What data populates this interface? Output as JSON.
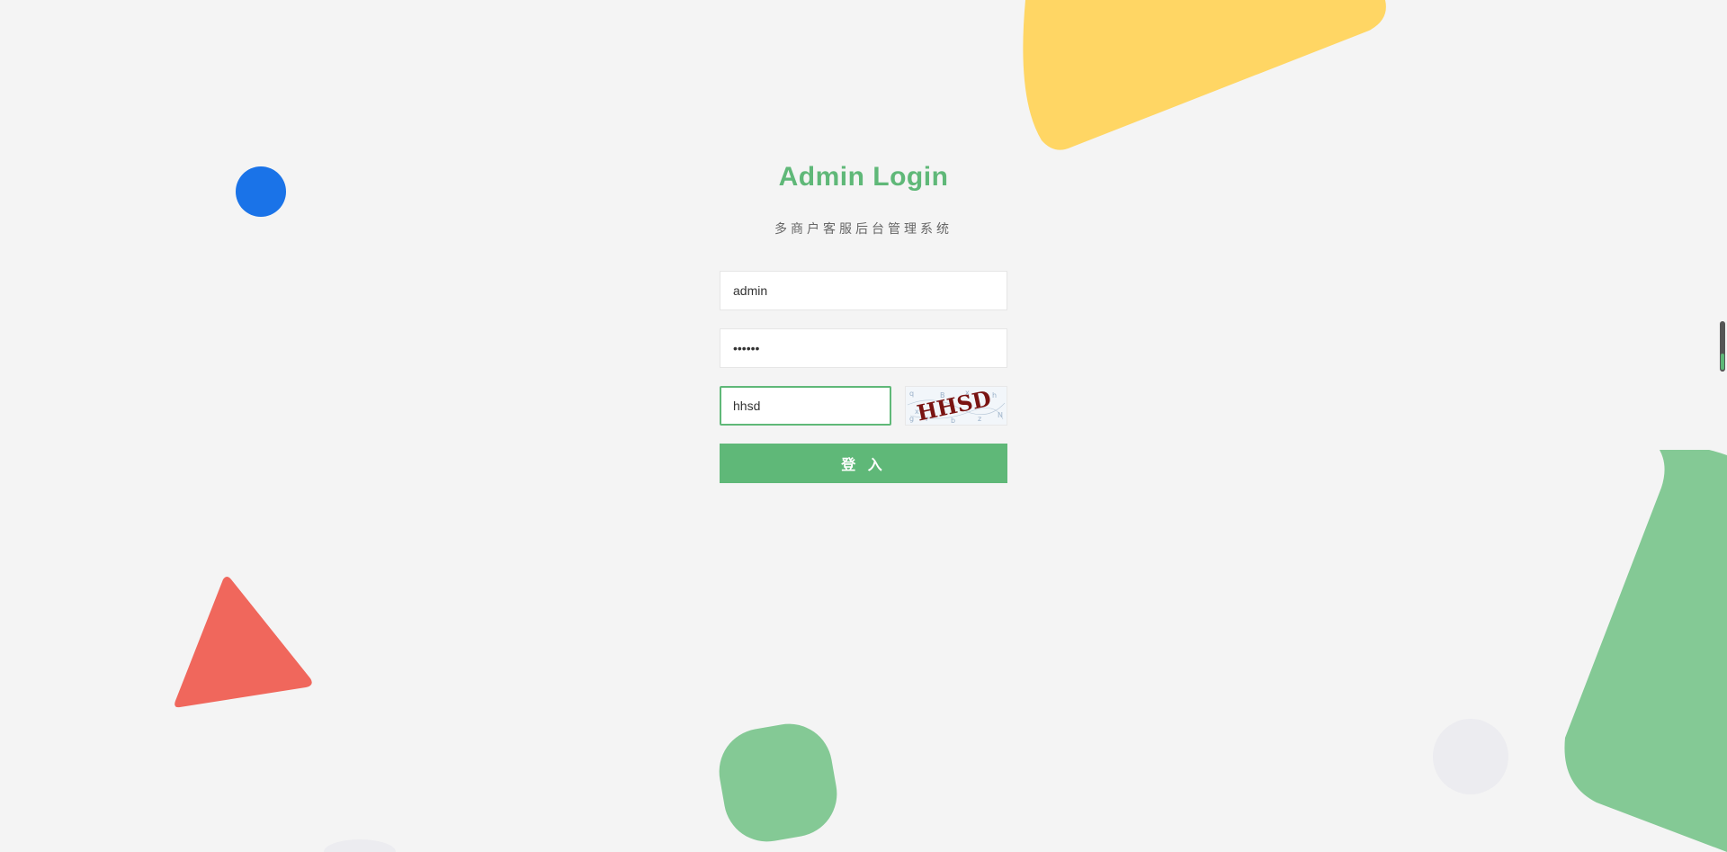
{
  "login": {
    "title": "Admin Login",
    "subtitle": "多商户客服后台管理系统",
    "username_value": "admin",
    "password_value": "••••••",
    "captcha_value": "hhsd",
    "captcha_image_text": "HHSD",
    "submit_label": "登 入"
  },
  "theme": {
    "accent": "#5fb878",
    "background": "#f4f4f4",
    "shape_yellow": "#ffd664",
    "shape_green": "#84c995",
    "shape_red": "#f0675c",
    "shape_blue": "#1a73e8"
  },
  "scroll_indicator": {
    "fill_fraction": 0.35
  }
}
